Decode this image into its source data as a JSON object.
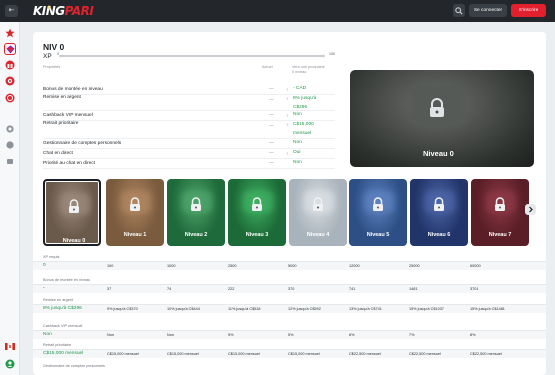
{
  "header": {
    "logo_left": "KING",
    "logo_right": "PARI",
    "back_icon": "collapse-icon",
    "login_label": "Se connecter",
    "signup_label": "S'inscrire"
  },
  "colors": {
    "brand_red": "#e2202e",
    "green": "#1d9a4a",
    "dark": "#23272b"
  },
  "sidebar": {
    "items": [
      "star-icon",
      "diamond-icon",
      "gift-icon",
      "shield-icon",
      "chip-icon",
      "circle-icon",
      "cards-icon",
      "flag-icon",
      "support-icon"
    ]
  },
  "level": {
    "title": "NIV 0",
    "xp_label": "XP",
    "xp_min": "0",
    "xp_max": "100",
    "xp_progress": 0
  },
  "benefits": {
    "header_actual": "Actuel",
    "header_next": "Vers une prochaine",
    "header_next2": "0 niveau",
    "header_props": "Propriétés",
    "rows": [
      {
        "name": "Bonus de montée en niveau",
        "current": "—",
        "next": "- CAD",
        "check": true
      },
      {
        "name": "Remise en argent",
        "current": "—",
        "next": "8% jusqu'à C$296",
        "check": true
      },
      {
        "name": "Cashback VIP mensuel",
        "current": "—",
        "next": "Non",
        "check": true
      },
      {
        "name": "Retrait prioritaire",
        "current": "—",
        "next": "C$15,000 mensuel",
        "check": true
      },
      {
        "name": "Gestionnaire de comptes personnels",
        "current": "—",
        "next": "Non",
        "check": false
      },
      {
        "name": "Chat en direct",
        "current": "—",
        "next": "Oui",
        "check": true
      },
      {
        "name": "Priorité au chat en direct",
        "current": "—",
        "next": "Non",
        "check": false
      }
    ]
  },
  "preview": {
    "name": "Niveau 0",
    "next_icon": "chevron-right-icon"
  },
  "levels": [
    {
      "name": "Niveau 0",
      "bg": "#6a5a4b",
      "glow": "#9a8878"
    },
    {
      "name": "Niveau 1",
      "bg": "#7a5b3e",
      "glow": "#b08660"
    },
    {
      "name": "Niveau 2",
      "bg": "#1f6a3a",
      "glow": "#4ea56b"
    },
    {
      "name": "Niveau 3",
      "bg": "#1c6a37",
      "glow": "#3fb062"
    },
    {
      "name": "Niveau 4",
      "bg": "#a9b3bb",
      "glow": "#d9dee2"
    },
    {
      "name": "Niveau 5",
      "bg": "#2d4f86",
      "glow": "#5e82c0"
    },
    {
      "name": "Niveau 6",
      "bg": "#22356a",
      "glow": "#4d66a8"
    },
    {
      "name": "Niveau 7",
      "bg": "#5a1e26",
      "glow": "#8c3946"
    }
  ],
  "table": {
    "sections": [
      {
        "label": "XP requis",
        "cells": [
          "0",
          "100",
          "1000",
          "2500",
          "5000",
          "12000",
          "25000",
          "60000"
        ]
      },
      {
        "label": "Bonus de montée en niveau",
        "cells": [
          "-",
          "37",
          "74",
          "222",
          "370",
          "741",
          "1481",
          "3701"
        ]
      },
      {
        "label": "Remise en argent",
        "cells": [
          "8% jusqu'à C$296",
          "9% jusqu'à C$370",
          "10% jusqu'à C$444",
          "11% jusqu'à C$518",
          "12% jusqu'à C$592",
          "13% jusqu'à C$741",
          "15% jusqu'à C$1037",
          "15% jusqu'à C$1481"
        ]
      },
      {
        "label": "Cashback VIP mensuel",
        "cells": [
          "Non",
          "Non",
          "Non",
          "5%",
          "5%",
          "6%",
          "7%",
          "8%"
        ]
      },
      {
        "label": "Retrait prioritaire",
        "cells": [
          "C$15,000 mensuel",
          "C$15,000 mensuel",
          "C$15,000 mensuel",
          "C$15,000 mensuel",
          "C$15,000 mensuel",
          "C$22,500 mensuel",
          "C$22,500 mensuel",
          "C$22,500 mensuel"
        ]
      },
      {
        "label": "Gestionnaire de comptes personnels",
        "cells": []
      }
    ]
  }
}
